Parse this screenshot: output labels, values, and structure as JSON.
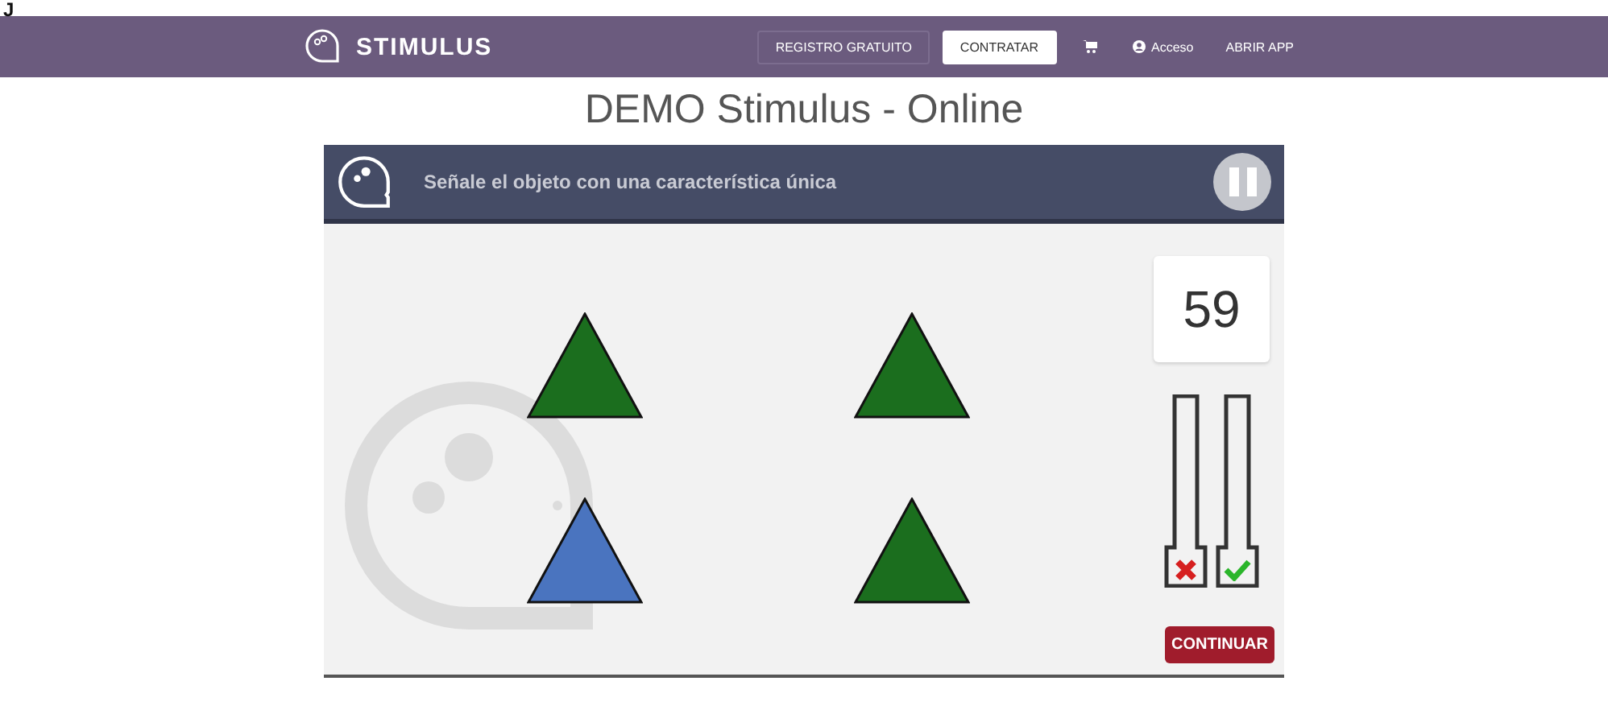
{
  "stray_text": "J",
  "navbar": {
    "brand": "STIMULUS",
    "buttons": [
      {
        "label": "REGISTRO GRATUITO",
        "kind": "outline"
      },
      {
        "label": "CONTRATAR",
        "kind": "solid"
      }
    ],
    "links": [
      {
        "label": "Acceso",
        "kind": "user"
      },
      {
        "label": "ABRIR APP",
        "kind": "plain"
      }
    ]
  },
  "page_title": "DEMO Stimulus - Online",
  "game": {
    "instruction": "Señale el objeto con una característica única",
    "shapes": [
      {
        "color": "#1b6e1e"
      },
      {
        "color": "#1b6e1e"
      },
      {
        "color": "#4a74bf"
      },
      {
        "color": "#1b6e1e"
      }
    ],
    "timer": "59",
    "meters": [
      {
        "kind": "wrong"
      },
      {
        "kind": "right"
      }
    ],
    "continue_button": "CONTINUAR"
  }
}
